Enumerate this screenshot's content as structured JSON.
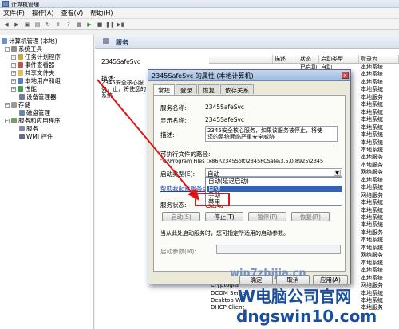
{
  "window": {
    "title": "计算机管理"
  },
  "menu": [
    "文件(F)",
    "操作(A)",
    "查看(V)",
    "帮助(H)"
  ],
  "tree": {
    "root": "计算机管理 (本地)",
    "system_tools": "系统工具",
    "task_scheduler": "任务计划程序",
    "event_viewer": "事件查看器",
    "shared_folders": "共享文件夹",
    "local_users": "本地用户和组",
    "performance": "性能",
    "device_manager": "设备管理器",
    "storage": "存储",
    "disk_management": "磁盘管理",
    "services_apps": "服务和应用程序",
    "services": "服务",
    "wmi": "WMI 控件"
  },
  "pane": {
    "header": "服务",
    "service_name": "2345SafeSvc",
    "desc_label": "描述:",
    "desc_text": "2345安全核心服务，止，将使您的系统"
  },
  "list": {
    "columns": [
      "",
      "描述",
      "状态",
      "启动类型",
      "登录为"
    ],
    "rows": [
      {
        "name": "",
        "desc": "",
        "status": "已启动",
        "type": "自动",
        "logon": "本地系统"
      },
      {
        "name": "",
        "desc": "",
        "status": "",
        "type": "",
        "logon": "本地系统"
      },
      {
        "name": "",
        "desc": "",
        "status": "",
        "type": "",
        "logon": "本地系统"
      },
      {
        "name": "",
        "desc": "",
        "status": "",
        "type": "",
        "logon": "本地系统"
      },
      {
        "name": "",
        "desc": "",
        "status": "",
        "type": "",
        "logon": "本地服务"
      },
      {
        "name": "",
        "desc": "",
        "status": "",
        "type": "",
        "logon": "本地系统"
      },
      {
        "name": "",
        "desc": "",
        "status": "",
        "type": "",
        "logon": "本地系统"
      },
      {
        "name": "",
        "desc": "",
        "status": "",
        "type": "",
        "logon": "本地系统"
      },
      {
        "name": "",
        "desc": "",
        "status": "",
        "type": "",
        "logon": "本地系统"
      },
      {
        "name": "",
        "desc": "",
        "status": "",
        "type": "",
        "logon": "本地系统"
      },
      {
        "name": "",
        "desc": "",
        "status": "",
        "type": "",
        "logon": "本地系统"
      },
      {
        "name": "",
        "desc": "",
        "status": "",
        "type": "",
        "logon": "本地系统"
      },
      {
        "name": "",
        "desc": "",
        "status": "",
        "type": "",
        "logon": "本地服务"
      },
      {
        "name": "",
        "desc": "",
        "status": "",
        "type": "",
        "logon": "本地服务"
      },
      {
        "name": "",
        "desc": "",
        "status": "",
        "type": "",
        "logon": "网络服务"
      },
      {
        "name": "",
        "desc": "",
        "status": "",
        "type": "",
        "logon": "本地系统"
      },
      {
        "name": "",
        "desc": "",
        "status": "",
        "type": "",
        "logon": "本地系统"
      },
      {
        "name": "",
        "desc": "",
        "status": "",
        "type": "",
        "logon": "网络服务"
      },
      {
        "name": "",
        "desc": "",
        "status": "",
        "type": "",
        "logon": "本地系统"
      },
      {
        "name": "",
        "desc": "",
        "status": "",
        "type": "",
        "logon": "本地系统"
      },
      {
        "name": "",
        "desc": "",
        "status": "",
        "type": "",
        "logon": "本地系统"
      },
      {
        "name": "",
        "desc": "",
        "status": "",
        "type": "",
        "logon": "本地系统"
      },
      {
        "name": "",
        "desc": "",
        "status": "",
        "type": "",
        "logon": "本地服务"
      },
      {
        "name": "",
        "desc": "",
        "status": "",
        "type": "",
        "logon": "本地系统"
      },
      {
        "name": "",
        "desc": "",
        "status": "",
        "type": "",
        "logon": "本地系统"
      },
      {
        "name": "",
        "desc": "",
        "status": "",
        "type": "",
        "logon": "网络服务"
      },
      {
        "name": "",
        "desc": "",
        "status": "",
        "type": "",
        "logon": "本地系统"
      },
      {
        "name": "",
        "desc": "",
        "status": "",
        "type": "",
        "logon": "本地系统"
      },
      {
        "name": "Credenti",
        "desc": "",
        "status": "",
        "type": "",
        "logon": "本地系统"
      },
      {
        "name": "Cryptogra",
        "desc": "",
        "status": "",
        "type": "",
        "logon": "网络服务"
      },
      {
        "name": "DCOM Server",
        "desc": "",
        "status": "",
        "type": "",
        "logon": "本地系统"
      },
      {
        "name": "Desktop Wi",
        "desc": "",
        "status": "",
        "type": "",
        "logon": "本地系统"
      },
      {
        "name": "DHCP Client",
        "desc": "",
        "status": "",
        "type": "",
        "logon": "本地服务"
      }
    ]
  },
  "dialog": {
    "title": "2345SafeSvc 的属性 (本地计算机)",
    "close": "x",
    "tabs": [
      "常规",
      "登录",
      "恢复",
      "依存关系"
    ],
    "service_name_label": "服务名称:",
    "service_name": "2345SafeSvc",
    "display_name_label": "显示名称:",
    "display_name": "2345SafeSvc",
    "desc_label": "描述:",
    "desc": "2345安全核心服务，如果该服务被停止，将使您的系统面临严重安全威胁",
    "path_label": "可执行文件的路径:",
    "path": "\"C:\\Program Files (x86)\\2345Soft\\2345PCSafe\\3.5.0.8925\\2345",
    "startup_label": "启动类型(E):",
    "startup_value": "自动",
    "help_link": "帮助我配置服务启动选项。",
    "status_label": "服务状态:",
    "status_value": "已启动",
    "buttons": [
      "启动(S)",
      "停止(T)",
      "暂停(P)",
      "恢复(R)"
    ],
    "hint": "当从此处启动服务时，您可指定所适用的启动参数。",
    "params_label": "启动参数(M):",
    "ok": "确定",
    "cancel": "取消",
    "apply": "应用(A)"
  },
  "dropdown": {
    "options": [
      "自动(延迟启动)",
      "自动",
      "手动",
      "禁用"
    ],
    "selected_index": 1
  },
  "watermark": {
    "line1": "win7zhijia.cn",
    "line2": "W电脑公司官网",
    "line3": "dngswin10.com"
  },
  "colors": {
    "annotation_red": "#e01515",
    "selection_blue": "#3161b8",
    "watermark_blue": "#1a4fa0"
  }
}
